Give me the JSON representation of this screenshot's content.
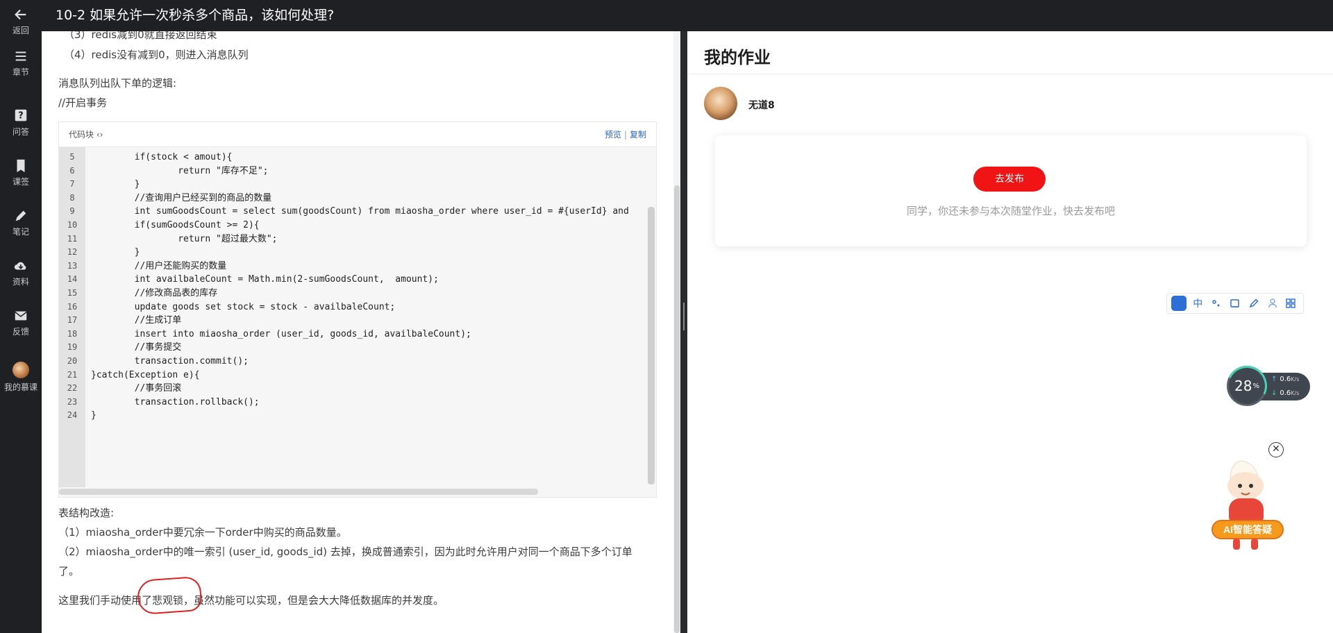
{
  "nav": {
    "back": "返回",
    "chapters": "章节",
    "qa": "问答",
    "bookmarks": "课签",
    "notes": "笔记",
    "materials": "资料",
    "feedback": "反馈",
    "my_course": "我的慕课"
  },
  "topbar": {
    "title": "10-2 如果允许一次秒杀多个商品，该如何处理?"
  },
  "article": {
    "line1": "（3）redis减到0就直接返回结束",
    "line2": "（4）redis没有减到0，则进入消息队列",
    "line3": "消息队列出队下单的逻辑:",
    "line4": "//开启事务",
    "code_label": "代码块 ‹›",
    "preview": "预览",
    "copy": "复制",
    "code": [
      {
        "n": "5",
        "t": "        if(stock < amout){"
      },
      {
        "n": "6",
        "t": "                return \"库存不足\";"
      },
      {
        "n": "7",
        "t": "        }"
      },
      {
        "n": "8",
        "t": "        //查询用户已经买到的商品的数量"
      },
      {
        "n": "9",
        "t": "        int sumGoodsCount = select sum(goodsCount) from miaosha_order where user_id = #{userId} and"
      },
      {
        "n": "10",
        "t": "        if(sumGoodsCount >= 2){"
      },
      {
        "n": "11",
        "t": "                return \"超过最大数\";"
      },
      {
        "n": "12",
        "t": "        }"
      },
      {
        "n": "13",
        "t": "        //用户还能购买的数量"
      },
      {
        "n": "14",
        "t": "        int availbaleCount = Math.min(2-sumGoodsCount,  amount);"
      },
      {
        "n": "15",
        "t": "        //修改商品表的库存"
      },
      {
        "n": "16",
        "t": "        update goods set stock = stock - availbaleCount;"
      },
      {
        "n": "17",
        "t": "        //生成订单"
      },
      {
        "n": "18",
        "t": "        insert into miaosha_order (user_id, goods_id, availbaleCount);"
      },
      {
        "n": "19",
        "t": "        //事务提交"
      },
      {
        "n": "20",
        "t": "        transaction.commit();"
      },
      {
        "n": "21",
        "t": "}catch(Exception e){"
      },
      {
        "n": "22",
        "t": "        //事务回滚"
      },
      {
        "n": "23",
        "t": "        transaction.rollback();"
      },
      {
        "n": "24",
        "t": "}"
      }
    ],
    "line5": "表结构改造:",
    "line6": "（1）miaosha_order中要冗余一下order中购买的商品数量。",
    "line7": "（2）miaosha_order中的唯一索引 (user_id, goods_id) 去掉，换成普通索引，因为此时允许用户对同一个商品下多个订单",
    "line8": "了。",
    "line9": "这里我们手动使用了悲观锁，虽然功能可以实现，但是会大大降低数据库的并发度。"
  },
  "homework": {
    "title": "我的作业",
    "username": "无道8",
    "publish_button": "去发布",
    "hint": "同学，你还未参与本次随堂作业，快去发布吧"
  },
  "toolbar": {
    "du": "du",
    "zh": "中"
  },
  "speed": {
    "percent": "28",
    "percent_unit": "%",
    "up": "0.6",
    "down": "0.6",
    "unit": "K/s"
  },
  "mascot": {
    "label": "AI智能答疑"
  },
  "colors": {
    "accent": "#f01414",
    "link": "#2a63c7",
    "nav_bg": "#1f2024"
  }
}
